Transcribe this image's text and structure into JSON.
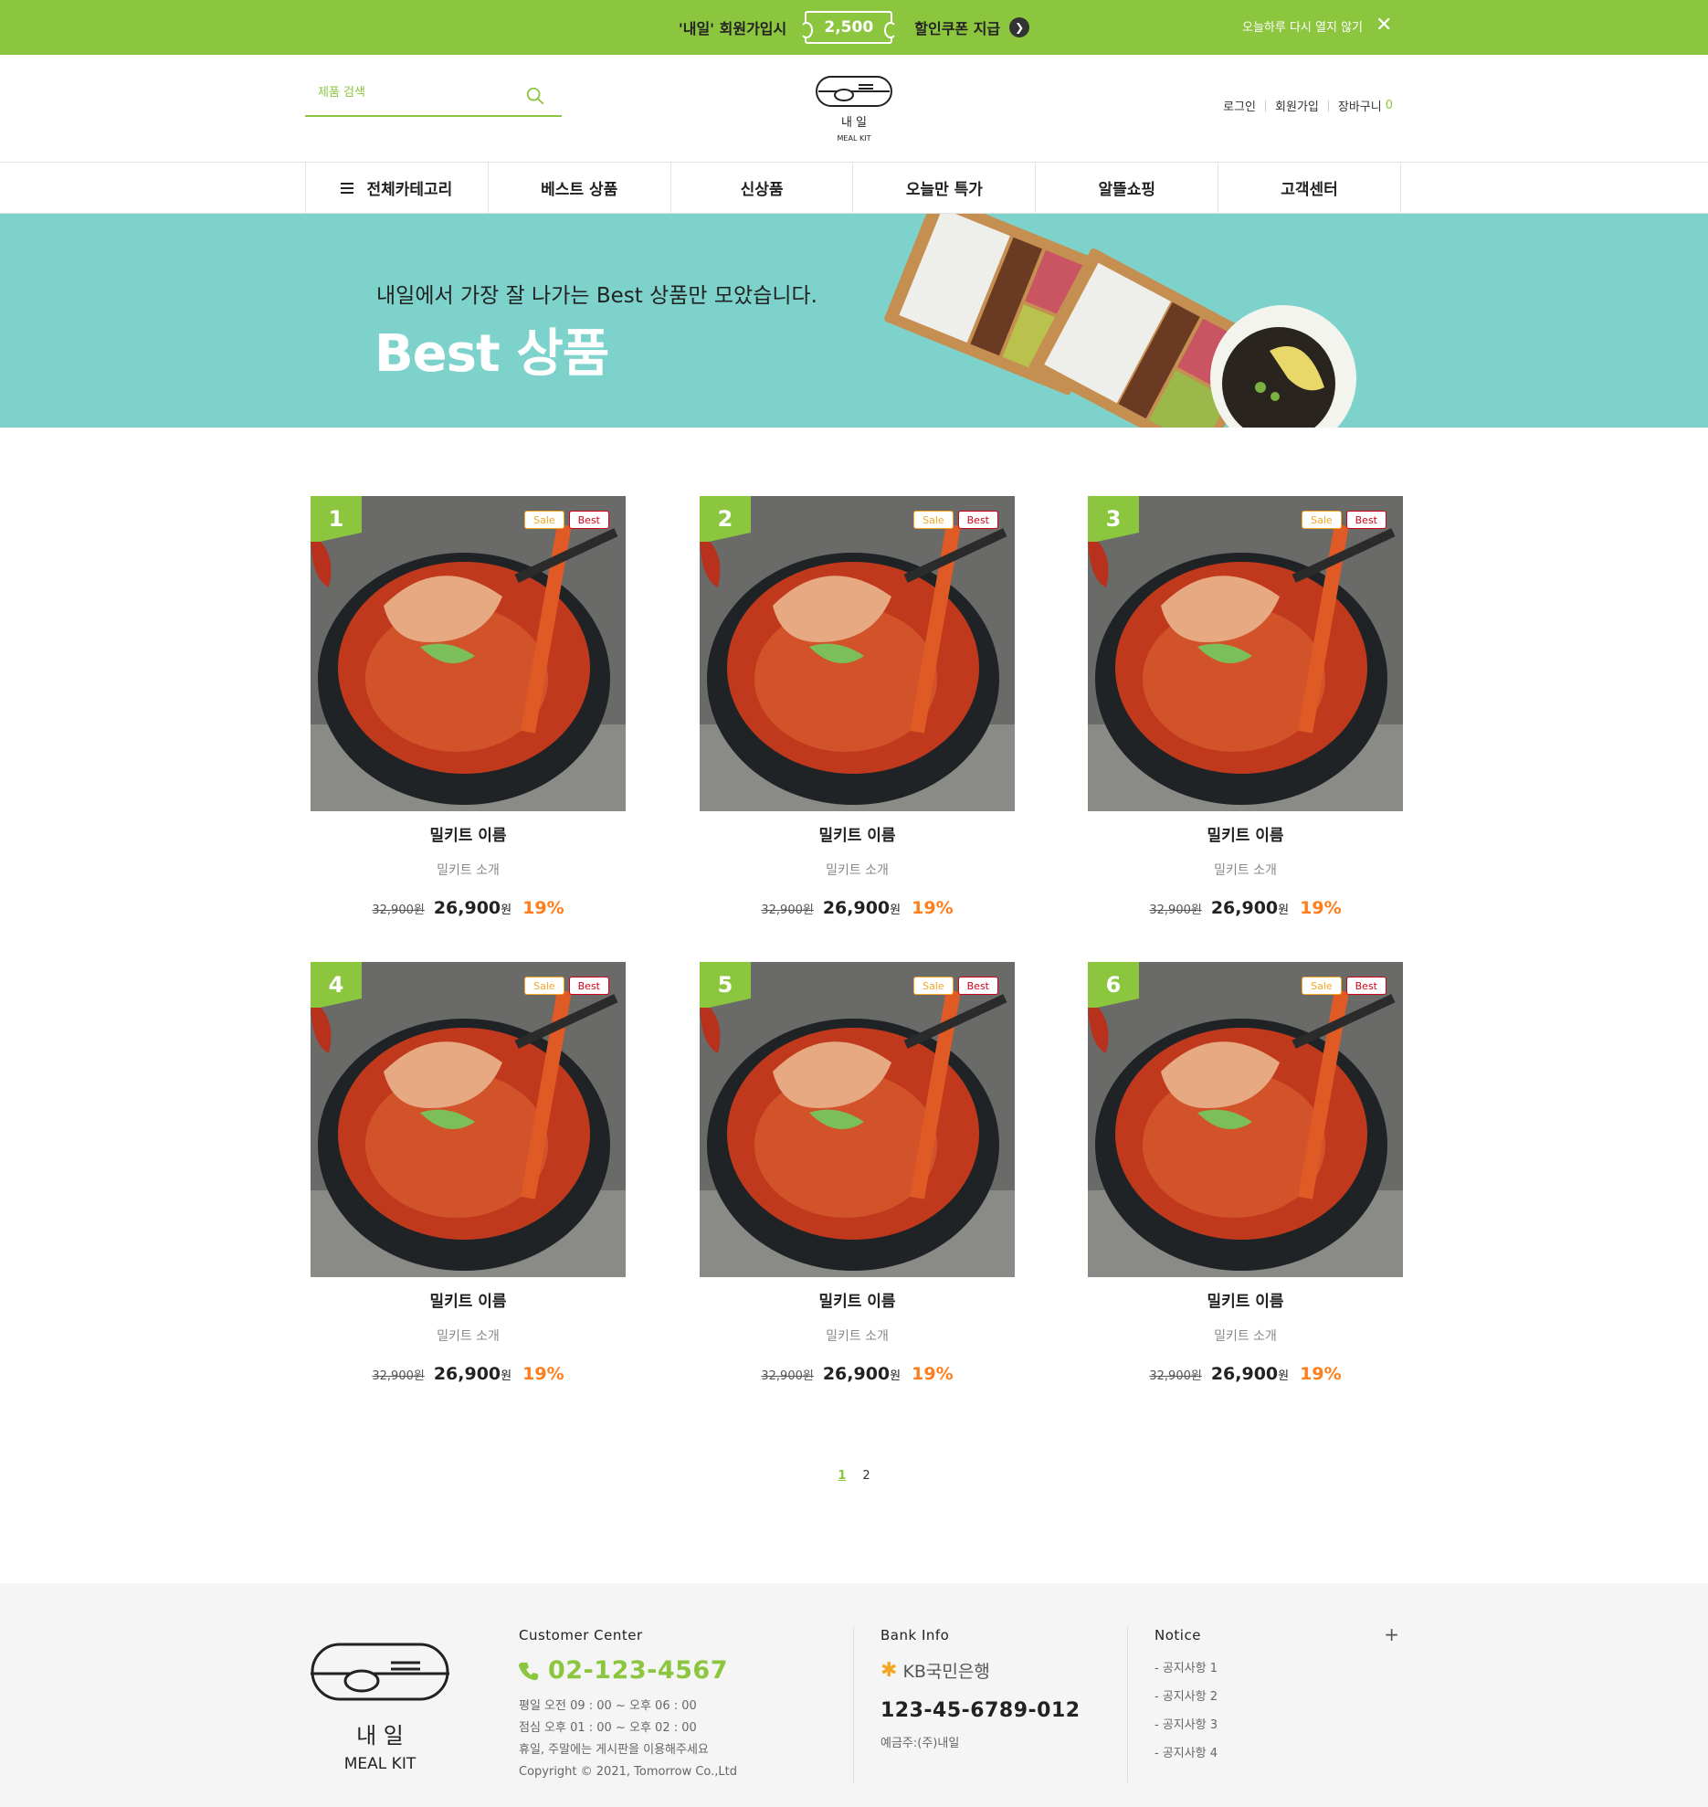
{
  "promo": {
    "pre": "'내일' 회원가입시",
    "amount": "2,500",
    "post": "할인쿠폰 지급",
    "dismiss": "오늘하루 다시 열지 않기"
  },
  "header": {
    "search_placeholder": "제품 검색",
    "logo_top": "내    일",
    "logo_sub": "MEAL KIT",
    "util": {
      "login": "로그인",
      "join": "회원가입",
      "cart": "장바구니",
      "cart_count": "0"
    }
  },
  "nav": {
    "items": [
      "전체카테고리",
      "베스트 상품",
      "신상품",
      "오늘만 특가",
      "알뜰쇼핑",
      "고객센터"
    ]
  },
  "banner": {
    "subtitle": "내일에서 가장 잘 나가는 Best 상품만 모았습니다.",
    "title": "Best 상품"
  },
  "products": [
    {
      "rank": "1",
      "sale": "Sale",
      "best": "Best",
      "name": "밀키트 이름",
      "desc": "밀키트 소개",
      "orig": "32,900원",
      "price": "26,900",
      "won": "원",
      "rate": "19%"
    },
    {
      "rank": "2",
      "sale": "Sale",
      "best": "Best",
      "name": "밀키트 이름",
      "desc": "밀키트 소개",
      "orig": "32,900원",
      "price": "26,900",
      "won": "원",
      "rate": "19%"
    },
    {
      "rank": "3",
      "sale": "Sale",
      "best": "Best",
      "name": "밀키트 이름",
      "desc": "밀키트 소개",
      "orig": "32,900원",
      "price": "26,900",
      "won": "원",
      "rate": "19%"
    },
    {
      "rank": "4",
      "sale": "Sale",
      "best": "Best",
      "name": "밀키트 이름",
      "desc": "밀키트 소개",
      "orig": "32,900원",
      "price": "26,900",
      "won": "원",
      "rate": "19%"
    },
    {
      "rank": "5",
      "sale": "Sale",
      "best": "Best",
      "name": "밀키트 이름",
      "desc": "밀키트 소개",
      "orig": "32,900원",
      "price": "26,900",
      "won": "원",
      "rate": "19%"
    },
    {
      "rank": "6",
      "sale": "Sale",
      "best": "Best",
      "name": "밀키트 이름",
      "desc": "밀키트 소개",
      "orig": "32,900원",
      "price": "26,900",
      "won": "원",
      "rate": "19%"
    }
  ],
  "pagination": {
    "pages": [
      "1",
      "2"
    ],
    "current": "1"
  },
  "footer": {
    "logo_top": "내    일",
    "logo_sub": "MEAL KIT",
    "customer": {
      "title": "Customer Center",
      "tel": "02-123-4567",
      "hours": [
        "평일 오전 09 : 00 ~ 오후 06 : 00",
        "점심 오후 01 : 00 ~ 오후 02 : 00",
        "휴일, 주말에는 게시판을 이용해주세요",
        "Copyright © 2021, Tomorrow Co.,Ltd"
      ]
    },
    "bank": {
      "title": "Bank Info",
      "name": "KB국민은행",
      "account": "123-45-6789-012",
      "holder": "예금주:(주)내일"
    },
    "notice": {
      "title": "Notice",
      "more": "+",
      "items": [
        "- 공지사항 1",
        "- 공지사항 2",
        "- 공지사항 3",
        "- 공지사항 4"
      ]
    }
  },
  "colors": {
    "accent": "#8cc63f",
    "banner": "#7dd3cb",
    "discount": "#ff7e1b",
    "footer_bg": "#f5f5f5"
  },
  "icons": {
    "search": "search-icon",
    "close": "close-icon",
    "menu": "menu-icon",
    "phone": "phone-icon",
    "arrow": "arrow-right-icon"
  }
}
